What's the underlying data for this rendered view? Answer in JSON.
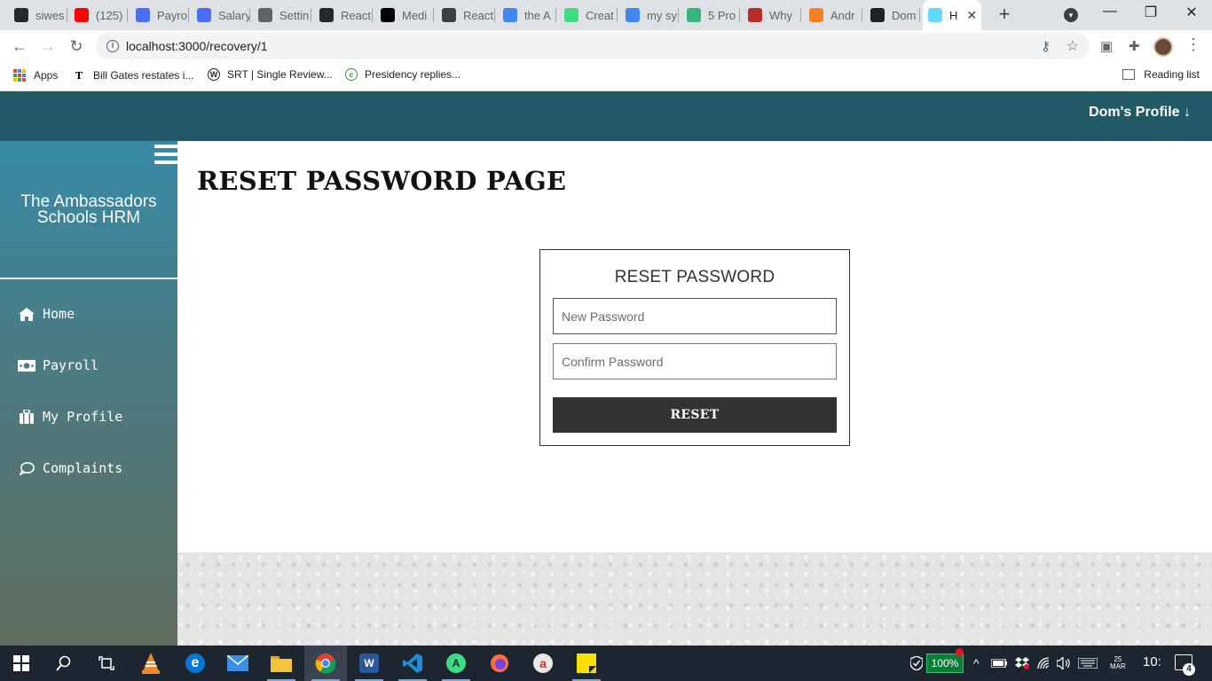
{
  "browser": {
    "tabs": [
      {
        "label": "siwes",
        "icon": "github-icon",
        "color": "#24292e"
      },
      {
        "label": "(125)",
        "icon": "youtube-icon",
        "color": "#ff0000"
      },
      {
        "label": "Payro",
        "icon": "globe-icon",
        "color": "#4a6cf7"
      },
      {
        "label": "Salary",
        "icon": "globe-icon",
        "color": "#4a6cf7"
      },
      {
        "label": "Settin",
        "icon": "settings-globe-icon",
        "color": "#5f6368"
      },
      {
        "label": "React",
        "icon": "github-icon",
        "color": "#24292e"
      },
      {
        "label": "Medi",
        "icon": "medium-icon",
        "color": "#000000"
      },
      {
        "label": "React",
        "icon": "diamond-icon",
        "color": "#3c4043"
      },
      {
        "label": "the A",
        "icon": "google-icon",
        "color": "#4285f4"
      },
      {
        "label": "Creat",
        "icon": "android-icon",
        "color": "#3ddc84"
      },
      {
        "label": "my sy",
        "icon": "google-icon",
        "color": "#4285f4"
      },
      {
        "label": "5 Pro",
        "icon": "bitbucket-icon",
        "color": "#36b37e"
      },
      {
        "label": "Why",
        "icon": "quora-icon",
        "color": "#b92b27"
      },
      {
        "label": "Andr",
        "icon": "stackoverflow-icon",
        "color": "#f48024"
      },
      {
        "label": "Dom",
        "icon": "feed-icon",
        "color": "#202124"
      },
      {
        "label": "H",
        "icon": "react-icon",
        "color": "#61dafb",
        "active": true
      }
    ],
    "url": "localhost:3000/recovery/1",
    "bookmarks": [
      {
        "label": "Apps",
        "icon": "apps-grid-icon"
      },
      {
        "label": "Bill Gates restates i...",
        "icon": "news-icon"
      },
      {
        "label": "SRT | Single Review...",
        "icon": "wordpress-icon"
      },
      {
        "label": "Presidency replies...",
        "icon": "site-icon"
      }
    ],
    "reading_list": "Reading list"
  },
  "app": {
    "profile_link": "Dom's Profile ↓",
    "brand": "The Ambassadors Schools HRM",
    "nav": [
      {
        "label": "Home",
        "icon": "home-icon"
      },
      {
        "label": "Payroll",
        "icon": "money-icon"
      },
      {
        "label": "My Profile",
        "icon": "briefcase-icon"
      },
      {
        "label": "Complaints",
        "icon": "comment-icon"
      }
    ],
    "page_title": "RESET PASSWORD PAGE",
    "form": {
      "title": "RESET PASSWORD",
      "new_password_placeholder": "New Password",
      "confirm_password_placeholder": "Confirm Password",
      "submit_label": "RESET"
    },
    "colors": {
      "topbar": "#215a66",
      "button": "#333333"
    }
  },
  "taskbar": {
    "battery": "100%",
    "clock": "10:",
    "lang_top": "25",
    "lang_bottom": "MAR",
    "notifications": "4"
  }
}
